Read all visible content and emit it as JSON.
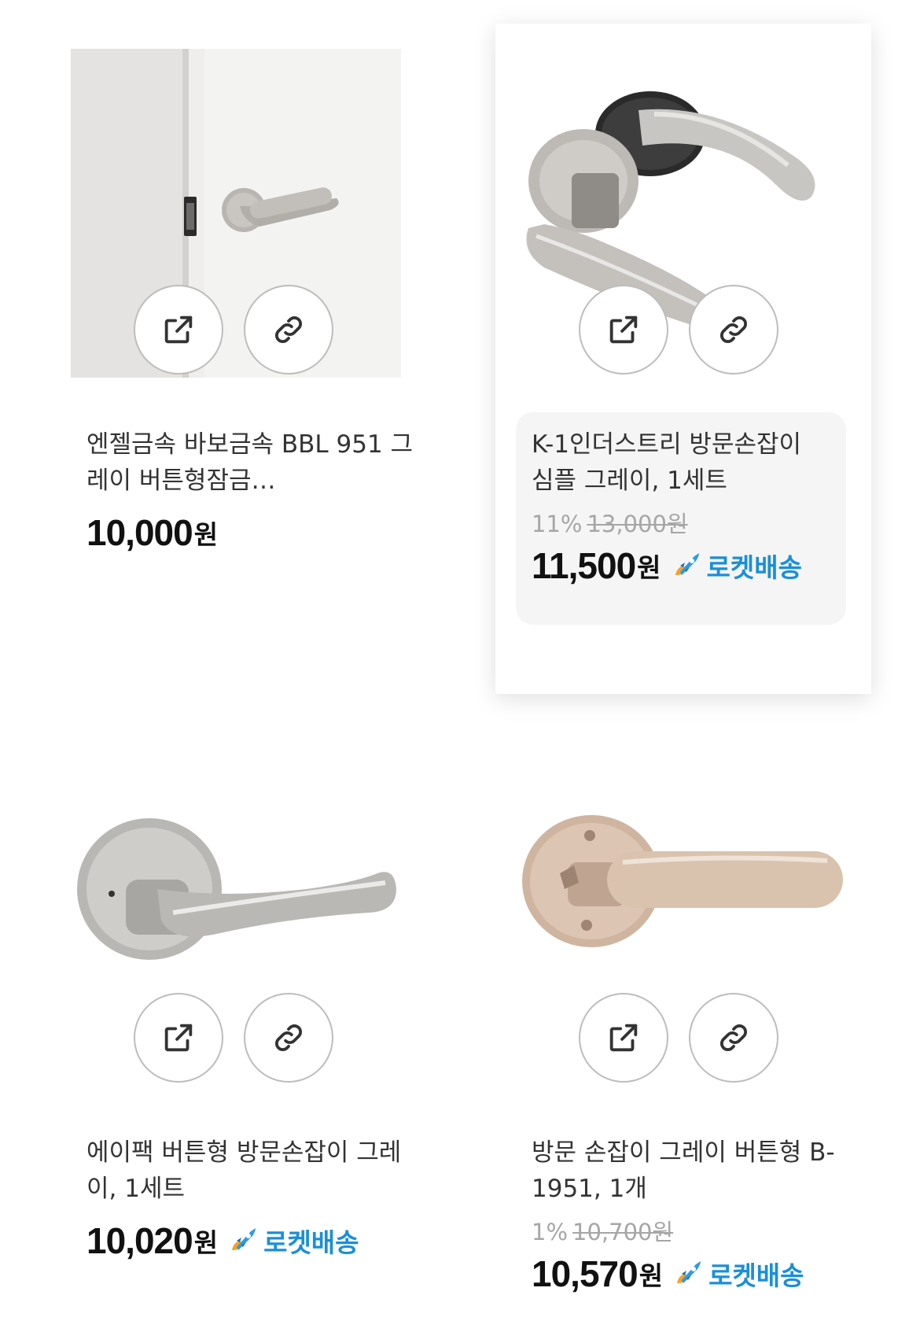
{
  "products": [
    {
      "title": "엔젤금속 바보금속 BBL 951 그레이 버튼형잠금…",
      "discount": "",
      "original_price": "",
      "price": "10,000",
      "currency": "원",
      "delivery": ""
    },
    {
      "title": "K-1인더스트리 방문손잡이 심플 그레이, 1세트",
      "discount": "11%",
      "original_price": "13,000원",
      "price": "11,500",
      "currency": "원",
      "delivery": "로켓배송"
    },
    {
      "title": "에이팩 버튼형 방문손잡이 그레이, 1세트",
      "discount": "",
      "original_price": "",
      "price": "10,020",
      "currency": "원",
      "delivery": "로켓배송"
    },
    {
      "title": "방문 손잡이 그레이 버튼형 B-1951, 1개",
      "discount": "1%",
      "original_price": "10,700원",
      "price": "10,570",
      "currency": "원",
      "delivery": "로켓배송"
    }
  ],
  "icons": {
    "open": "external-link-icon",
    "copy": "link-icon",
    "delivery": "rocket-icon"
  },
  "colors": {
    "rocket_blue": "#1a8fd8",
    "strike_gray": "#a6a6a6"
  }
}
